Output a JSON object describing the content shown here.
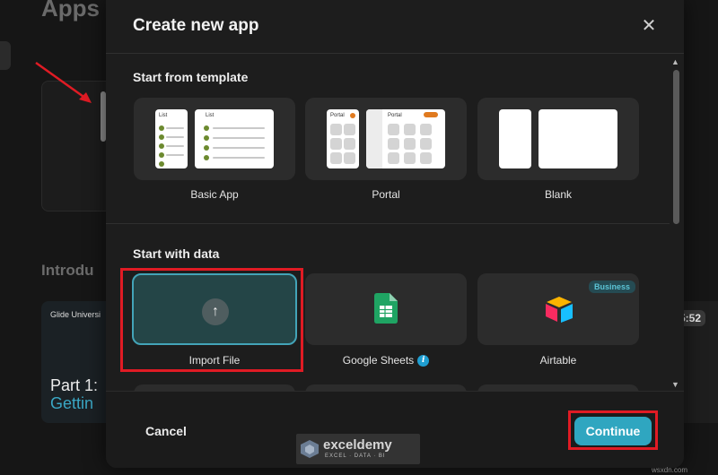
{
  "background": {
    "title": "Apps",
    "intro_heading": "Introdu",
    "video": {
      "brand": "Glide Universi",
      "part": "Part 1:",
      "subtitle": "Gettin",
      "duration": "5:52"
    }
  },
  "modal": {
    "title": "Create new app",
    "close_icon": "close-icon",
    "sections": [
      {
        "title": "Start from template",
        "tiles": [
          {
            "label": "Basic App",
            "thumb_texts": [
              "List",
              "List"
            ]
          },
          {
            "label": "Portal",
            "thumb_texts": [
              "Portal",
              "Portal"
            ]
          },
          {
            "label": "Blank"
          }
        ]
      },
      {
        "title": "Start with data",
        "tiles": [
          {
            "label": "Import File",
            "icon": "upload-arrow-icon",
            "selected": true
          },
          {
            "label": "Google Sheets",
            "icon": "google-sheets-icon",
            "info_icon": "i"
          },
          {
            "label": "Airtable",
            "icon": "airtable-icon",
            "badge": "Business"
          }
        ]
      }
    ],
    "footer": {
      "cancel_label": "Cancel",
      "continue_label": "Continue"
    }
  },
  "watermark": {
    "name": "exceldemy",
    "tagline": "EXCEL · DATA · BI"
  },
  "site_tag": "wsxdn.com",
  "colors": {
    "accent": "#2fa6c0",
    "selected_bg": "#244547",
    "highlight": "#e01b24",
    "sheets_green": "#1fa463"
  }
}
